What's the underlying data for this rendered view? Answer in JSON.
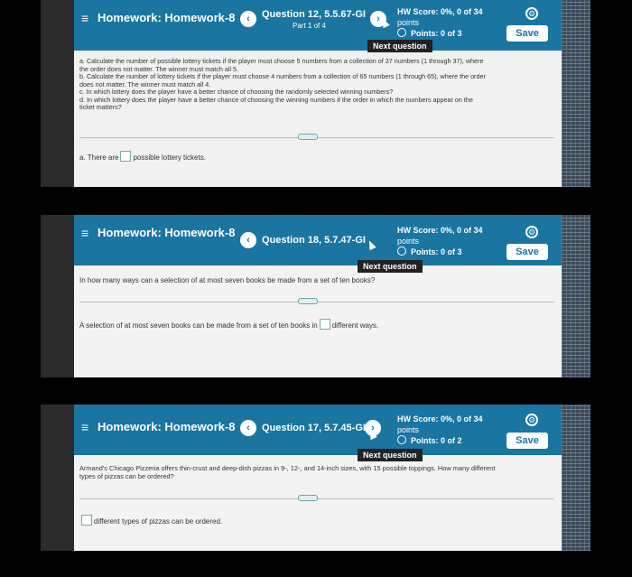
{
  "screens": [
    {
      "hw_title": "Homework: Homework-8",
      "question_title": "Question 12, 5.5.67-GI",
      "question_part": "Part 1 of 4",
      "hw_score": "HW Score: 0%, 0 of 34",
      "hw_score_unit": "points",
      "points": "Points: 0 of 3",
      "save_label": "Save",
      "next_tooltip": "Next question",
      "body_lines": [
        "a. Calculate the number of possible lottery tickets if the player must choose 5 numbers from a collection of 37 numbers (1 through 37), where",
        "the order does not matter. The winner must match all 5.",
        "b. Calculate the number of lottery tickets if the player must choose 4 numbers from a collection of 65 numbers (1 through 65), where the order",
        "does not matter. The winner must match all 4.",
        "c. In which lottery does the player have a better chance of choosing the randomly selected winning numbers?",
        "d. In which lottery does the player have a better chance of choosing the winning numbers if the order in which the numbers appear on the",
        "ticket matters?"
      ],
      "answer_prefix": "a. There are",
      "answer_suffix": "possible lottery tickets."
    },
    {
      "hw_title": "Homework: Homework-8",
      "question_title": "Question 18, 5.7.47-GI",
      "hw_score": "HW Score: 0%, 0 of 34",
      "hw_score_unit": "points",
      "points": "Points: 0 of 3",
      "save_label": "Save",
      "next_tooltip": "Next question",
      "question": "In how many ways can a selection of at most seven books be made from a set of ten books?",
      "answer_prefix": "A selection of at most seven books can be made from a set of ten books in",
      "answer_suffix": "different ways."
    },
    {
      "hw_title": "Homework: Homework-8",
      "question_title": "Question 17, 5.7.45-GI",
      "hw_score": "HW Score: 0%, 0 of 34",
      "hw_score_unit": "points",
      "points": "Points: 0 of 2",
      "save_label": "Save",
      "next_tooltip": "Next question",
      "question_lines": [
        "Armand's Chicago Pizzeria offers thin-crust and deep-dish pizzas in 9-, 12-, and 14-inch sizes, with 15 possible toppings. How many different",
        "types of pizzas can be ordered?"
      ],
      "answer_suffix": "different types of pizzas can be ordered."
    }
  ],
  "icons": {
    "menu": "hamburger-menu-icon",
    "back": "chevron-left-icon",
    "forward": "chevron-right-icon",
    "settings": "gear-icon",
    "points": "radio-circle-icon"
  },
  "colors": {
    "header": "#1a75a0",
    "background": "#000000"
  }
}
